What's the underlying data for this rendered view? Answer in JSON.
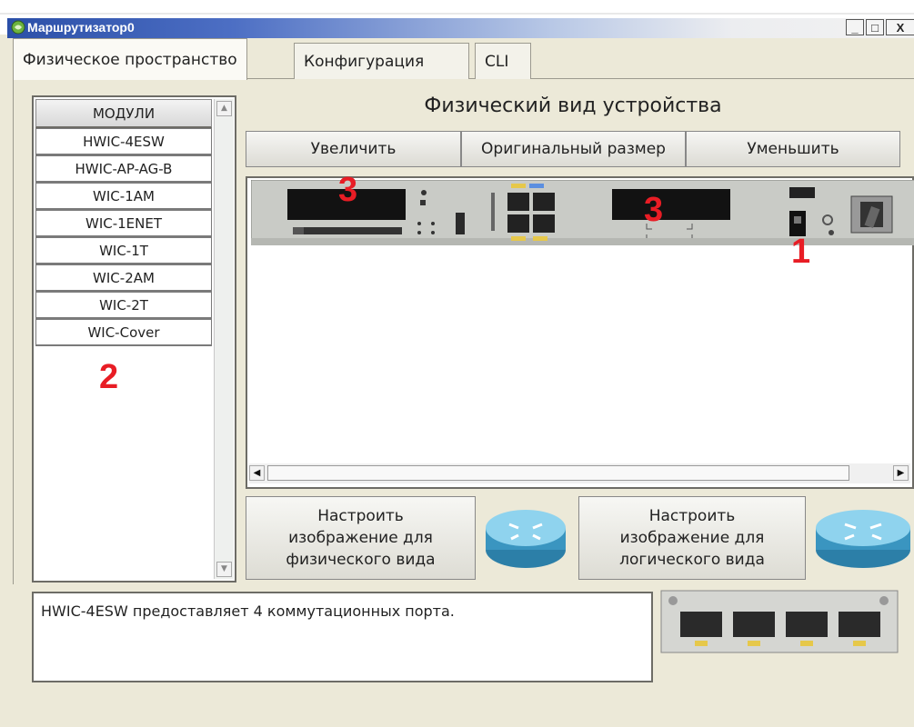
{
  "window": {
    "title": "Маршрутизатор0",
    "controls": {
      "minimize": "_",
      "maximize": "□",
      "close": "X"
    }
  },
  "tabs": [
    {
      "label": "Физическое пространство",
      "active": true
    },
    {
      "label": "Конфигурация",
      "active": false
    },
    {
      "label": "CLI",
      "active": false
    }
  ],
  "modules": {
    "header": "МОДУЛИ",
    "items": [
      "HWIC-4ESW",
      "HWIC-AP-AG-B",
      "WIC-1AM",
      "WIC-1ENET",
      "WIC-1T",
      "WIC-2AM",
      "WIC-2T",
      "WIC-Cover"
    ]
  },
  "physical_view": {
    "title": "Физический вид устройства",
    "zoom_in": "Увеличить",
    "original_size": "Оригинальный размер",
    "zoom_out": "Уменьшить"
  },
  "customize": {
    "physical": "Настроить\nизображение для\nфизического вида",
    "logical": "Настроить\nизображение для\nлогического вида"
  },
  "description": "HWIC-4ESW предоставляет 4 коммутационных порта.",
  "annotations": {
    "power": "1",
    "modules_list": "2",
    "slot": "3"
  },
  "colors": {
    "title_bar": "#2b4fa8",
    "annotation": "#e81d25",
    "background": "#ece9d8"
  },
  "icons": [
    "app-icon",
    "router-icon",
    "power-switch-icon",
    "ethernet-port-icon"
  ]
}
